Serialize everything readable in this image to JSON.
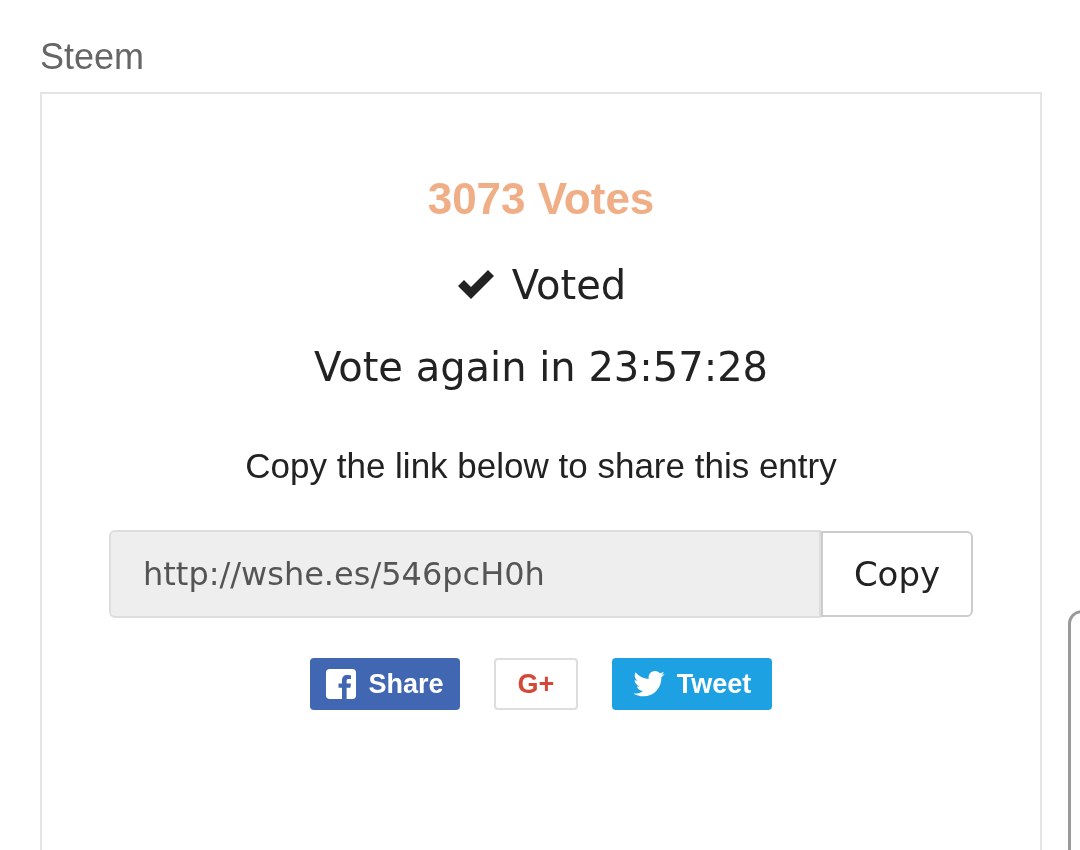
{
  "title": "Steem",
  "card": {
    "votes": "3073 Votes",
    "voted": true,
    "voted_label": "Voted",
    "countdown": "Vote again in 23:57:28",
    "share_prompt": "Copy the link below to share this entry",
    "link": {
      "value": "http://wshe.es/546pcH0h",
      "button": "Copy"
    },
    "share_buttons": [
      {
        "kind": "facebook",
        "label": "Share"
      },
      {
        "kind": "google",
        "label": "G+"
      },
      {
        "kind": "twitter",
        "label": "Tweet"
      }
    ]
  }
}
